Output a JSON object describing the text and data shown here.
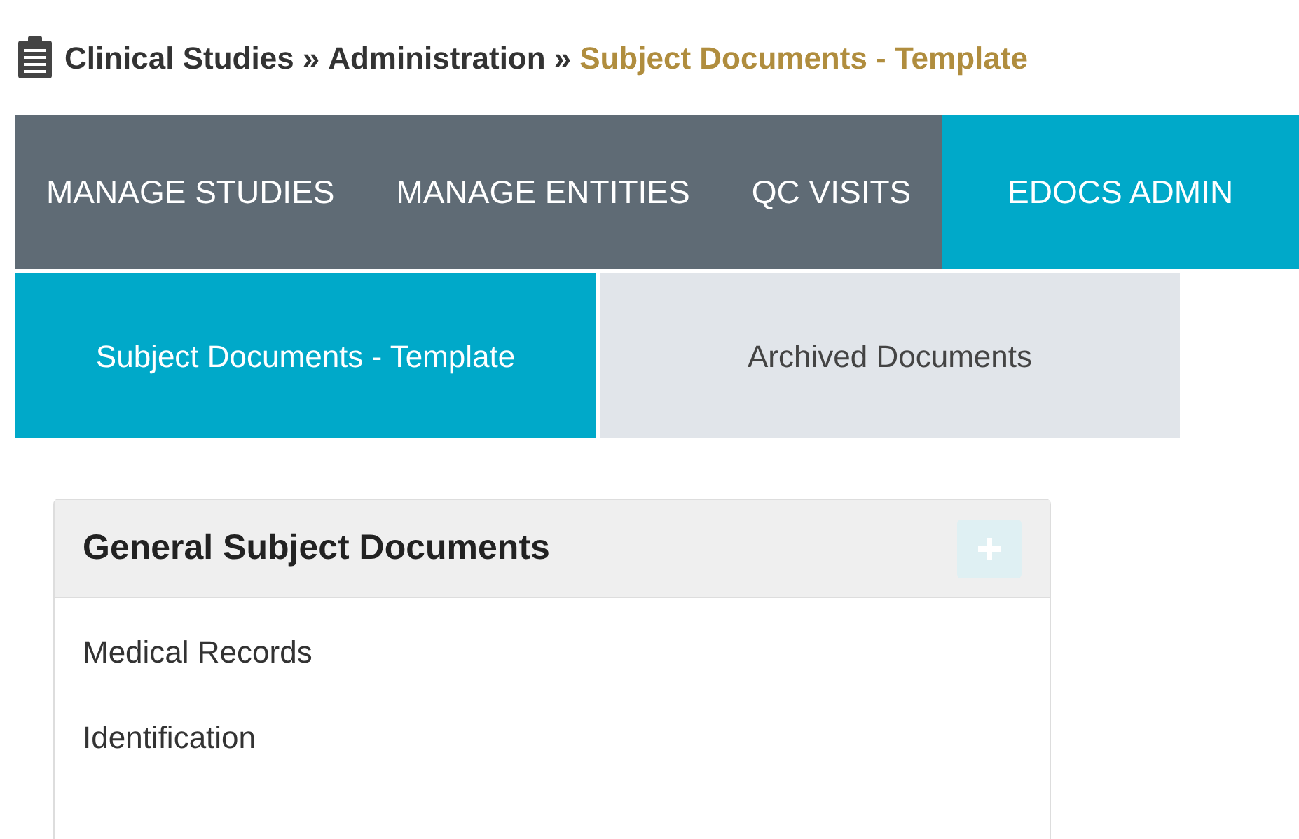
{
  "breadcrumb": [
    {
      "label": "Clinical Studies",
      "current": false
    },
    {
      "label": "»",
      "current": false
    },
    {
      "label": "Administration",
      "current": false
    },
    {
      "label": "»",
      "current": false
    },
    {
      "label": "Subject Documents - Template",
      "current": true
    }
  ],
  "nav": [
    {
      "label": "MANAGE STUDIES",
      "selected": false
    },
    {
      "label": "MANAGE ENTITIES",
      "selected": false
    },
    {
      "label": "QC VISITS",
      "selected": false
    },
    {
      "label": "EDOCS ADMIN",
      "selected": true
    }
  ],
  "subtabs": [
    {
      "label": "Subject Documents - Template",
      "selected": true
    },
    {
      "label": "Archived Documents",
      "selected": false
    }
  ],
  "panel": {
    "title": "General Subject Documents",
    "add_disabled": true,
    "items": [
      "Medical Records",
      "Identification"
    ]
  }
}
